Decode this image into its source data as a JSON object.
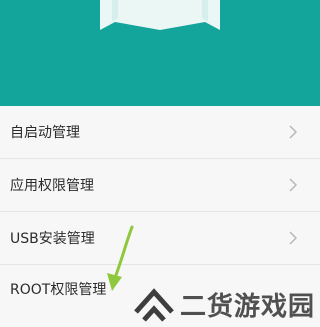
{
  "colors": {
    "header_bg": "#13a59b",
    "arrow": "#8fc73d",
    "text": "#2b2b2b"
  },
  "menu": {
    "items": [
      {
        "label": "自启动管理"
      },
      {
        "label": "应用权限管理"
      },
      {
        "label": "USB安装管理"
      },
      {
        "label": "ROOT权限管理"
      }
    ]
  },
  "watermark": {
    "text": "二货游戏园"
  },
  "icons": {
    "chevron": "chevron-right-icon",
    "logo": "watermark-logo"
  }
}
